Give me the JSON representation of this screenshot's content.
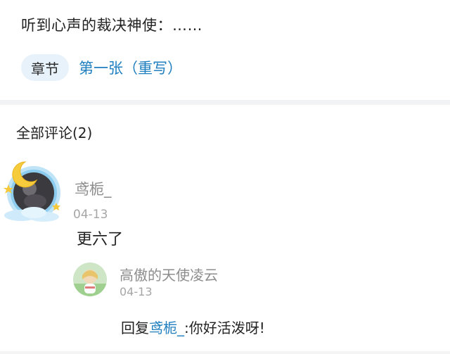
{
  "post": {
    "text": "听到心声的裁决神使：……"
  },
  "chapter": {
    "tag_label": "章节",
    "link_label": "第一张（重写）"
  },
  "comments": {
    "title": "全部评论(2)",
    "items": [
      {
        "author": "鸢栀_",
        "date": "04-13",
        "body": "更六了",
        "avatar_icon": "moon-star-avatar-frame-icon",
        "replies": [
          {
            "author": "高傲的天使凌云",
            "date": "04-13",
            "body_prefix": "回复",
            "mention": "鸢栀_",
            "body_suffix": ":你好活泼呀!",
            "avatar_icon": "anime-character-avatar-icon"
          }
        ]
      }
    ]
  },
  "colors": {
    "link": "#1f7fbf",
    "tag_bg": "#e7f2fb",
    "muted": "#8d8d8d"
  }
}
